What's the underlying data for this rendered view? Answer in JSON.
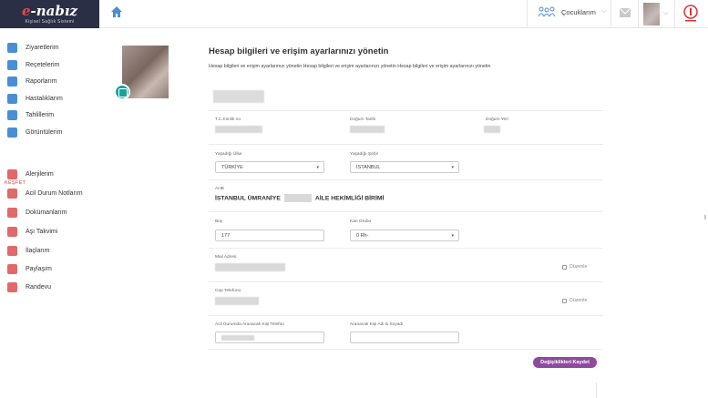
{
  "header": {
    "logo_e": "e",
    "logo_rest": "-nabız",
    "logo_sub": "Kişisel Sağlık Sistemi",
    "children_label": "Çocuklarım",
    "colors": {
      "logo_bg": "#2b2f45",
      "accent": "#8e4b9e"
    }
  },
  "sidebar": {
    "items": [
      {
        "label": "Ziyaretlerim",
        "icon": "building-icon"
      },
      {
        "label": "Reçetelerim",
        "icon": "prescription-icon"
      },
      {
        "label": "Raporlarım",
        "icon": "report-icon"
      },
      {
        "label": "Hastalıklarım",
        "icon": "disease-icon"
      },
      {
        "label": "Tahlillerim",
        "icon": "lab-test-icon"
      },
      {
        "label": "Görüntülerim",
        "icon": "image-scan-icon"
      }
    ],
    "section_label": "KEŞFET",
    "explore_items": [
      {
        "label": "Alerjilerim",
        "icon": "allergy-icon"
      },
      {
        "label": "Acil Durum Notlarım",
        "icon": "emergency-note-icon"
      },
      {
        "label": "Dokümanlarım",
        "icon": "document-icon"
      },
      {
        "label": "Aşı Takvimi",
        "icon": "vaccine-icon"
      },
      {
        "label": "İlaçlarım",
        "icon": "medication-icon"
      },
      {
        "label": "Paylaşım",
        "icon": "share-icon"
      },
      {
        "label": "Randevu",
        "icon": "appointment-icon"
      }
    ]
  },
  "main": {
    "title": "Hesap bilgileri ve erişim ayarlarınızı yönetin",
    "description": "Hesap bilgileri ve erişim ayarlarınızı yönetin Hesap bilgileri ve erişim ayarlarınızı yönetin Hesap bilgileri ve erişim ayarlarınızı yönetin",
    "fields": {
      "tc_label": "T.C.Kimlik no",
      "birth_date_label": "Doğum Tarihi",
      "birth_place_label": "Doğum Yeri",
      "country_label": "Yaşadığı Ülke",
      "country_value": "TÜRKİYE",
      "city_label": "Yaşadığı Şehir",
      "city_value": "İSTANBUL",
      "ahb_label": "AHB",
      "ahb_prefix": "İSTANBUL ÜMRANİYE",
      "ahb_suffix": "AİLE HEKİMLİĞİ BİRİMİ",
      "height_label": "Boy",
      "height_value": "177",
      "blood_label": "Kan Grubu",
      "blood_value": "0 Rh-",
      "email_label": "Mail Adresi",
      "phone_label": "Cep Telefonu",
      "emergency_phone_label": "Acil Durumda Aranacak Kişi Telefon",
      "emergency_name_label": "Aranacak Kişi Adı & Soyadı",
      "edit_label": "Düzenle"
    },
    "save_label": "Değişiklikleri Kaydet"
  }
}
